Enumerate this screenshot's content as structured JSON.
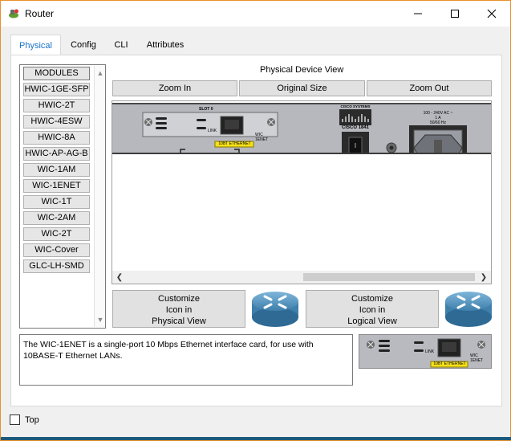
{
  "window": {
    "title": "Router",
    "icon": "router-app-icon",
    "controls": [
      "minimize-icon",
      "maximize-icon",
      "close-icon"
    ]
  },
  "tabs": [
    {
      "label": "Physical",
      "active": true
    },
    {
      "label": "Config",
      "active": false
    },
    {
      "label": "CLI",
      "active": false
    },
    {
      "label": "Attributes",
      "active": false
    }
  ],
  "modules": {
    "header": "MODULES",
    "items": [
      "HWIC-1GE-SFP",
      "HWIC-2T",
      "HWIC-4ESW",
      "HWIC-8A",
      "HWIC-AP-AG-B",
      "WIC-1AM",
      "WIC-1ENET",
      "WIC-1T",
      "WIC-2AM",
      "WIC-2T",
      "WIC-Cover",
      "GLC-LH-SMD"
    ]
  },
  "device_view": {
    "title": "Physical Device View",
    "zoom_in": "Zoom In",
    "original_size": "Original Size",
    "zoom_out": "Zoom Out",
    "slot_label": "SLOT 0",
    "link_label": "LINK",
    "module_label": "WIC\n1ENET",
    "port_label": "10BT ETHERNET",
    "brand": "CISCO SYSTEMS",
    "model": "CISCO 1841",
    "power_spec": "100 - 240V AC ~\n1 A\n50/60 Hz"
  },
  "customize": {
    "physical": "Customize\nIcon in\nPhysical View",
    "logical": "Customize\nIcon in\nLogical View"
  },
  "description": "The WIC-1ENET is a single-port 10 Mbps Ethernet interface card, for use with 10BASE-T Ethernet LANs.",
  "top_checkbox": {
    "label": "Top",
    "checked": false
  },
  "colors": {
    "accent": "#1a73c9",
    "chassis": "#b6b8bd",
    "port_label_bg": "#f5e11a"
  }
}
